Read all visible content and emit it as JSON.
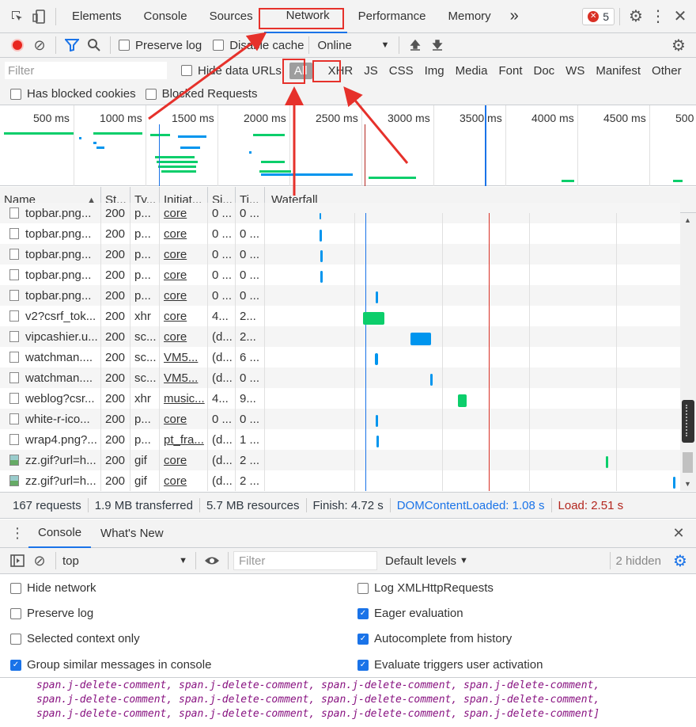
{
  "tabs": {
    "items": [
      "Elements",
      "Console",
      "Sources",
      "Network",
      "Performance",
      "Memory"
    ],
    "more": "»",
    "error_count": "5"
  },
  "toolbar": {
    "preserve_log": "Preserve log",
    "disable_cache": "Disable cache",
    "throttle": "Online"
  },
  "filter": {
    "placeholder": "Filter",
    "hide_data_urls": "Hide data URLs",
    "types": [
      "All",
      "XHR",
      "JS",
      "CSS",
      "Img",
      "Media",
      "Font",
      "Doc",
      "WS",
      "Manifest",
      "Other"
    ],
    "has_blocked_cookies": "Has blocked cookies",
    "blocked_requests": "Blocked Requests"
  },
  "overview": {
    "ticks": [
      "500 ms",
      "1000 ms",
      "1500 ms",
      "2000 ms",
      "2500 ms",
      "3000 ms",
      "3500 ms",
      "4000 ms",
      "4500 ms",
      "500"
    ]
  },
  "table": {
    "headers": [
      "Name",
      "St...",
      "Ty...",
      "Initiat...",
      "Si...",
      "Ti...",
      "Waterfall"
    ],
    "rows": [
      {
        "name": "topbar.png...",
        "status": "200",
        "type": "p...",
        "initiator": "core",
        "size": "0 ...",
        "time": "0 ...",
        "icon": "img"
      },
      {
        "name": "topbar.png...",
        "status": "200",
        "type": "p...",
        "initiator": "core",
        "size": "0 ...",
        "time": "0 ...",
        "icon": "img"
      },
      {
        "name": "topbar.png...",
        "status": "200",
        "type": "p...",
        "initiator": "core",
        "size": "0 ...",
        "time": "0 ...",
        "icon": "img"
      },
      {
        "name": "topbar.png...",
        "status": "200",
        "type": "p...",
        "initiator": "core",
        "size": "0 ...",
        "time": "0 ...",
        "icon": "img"
      },
      {
        "name": "topbar.png...",
        "status": "200",
        "type": "p...",
        "initiator": "core",
        "size": "0 ...",
        "time": "0 ...",
        "icon": "img"
      },
      {
        "name": "v2?csrf_tok...",
        "status": "200",
        "type": "xhr",
        "initiator": "core",
        "size": "4...",
        "time": "2...",
        "icon": "doc"
      },
      {
        "name": "vipcashier.u...",
        "status": "200",
        "type": "sc...",
        "initiator": "core",
        "size": "(d...",
        "time": "2...",
        "icon": "doc"
      },
      {
        "name": "watchman....",
        "status": "200",
        "type": "sc...",
        "initiator": "VM5...",
        "size": "(d...",
        "time": "6 ...",
        "icon": "doc"
      },
      {
        "name": "watchman....",
        "status": "200",
        "type": "sc...",
        "initiator": "VM5...",
        "size": "(d...",
        "time": "0 ...",
        "icon": "doc"
      },
      {
        "name": "weblog?csr...",
        "status": "200",
        "type": "xhr",
        "initiator": "music...",
        "size": "4...",
        "time": "9...",
        "icon": "doc"
      },
      {
        "name": "white-r-ico...",
        "status": "200",
        "type": "p...",
        "initiator": "core",
        "size": "0 ...",
        "time": "0 ...",
        "icon": "doc"
      },
      {
        "name": "wrap4.png?...",
        "status": "200",
        "type": "p...",
        "initiator": "pt_fra...",
        "size": "(d...",
        "time": "1 ...",
        "icon": "doc"
      },
      {
        "name": "zz.gif?url=h...",
        "status": "200",
        "type": "gif",
        "initiator": "core",
        "size": "(d...",
        "time": "2 ...",
        "icon": "pic"
      },
      {
        "name": "zz.gif?url=h...",
        "status": "200",
        "type": "gif",
        "initiator": "core",
        "size": "(d...",
        "time": "2 ...",
        "icon": "pic"
      }
    ]
  },
  "summary": {
    "requests": "167 requests",
    "transferred": "1.9 MB transferred",
    "resources": "5.7 MB resources",
    "finish": "Finish: 4.72 s",
    "dcl": "DOMContentLoaded: 1.08 s",
    "load": "Load: 2.51 s"
  },
  "drawer": {
    "tabs": [
      "Console",
      "What's New"
    ],
    "context": "top",
    "filter_placeholder": "Filter",
    "levels": "Default levels",
    "hidden": "2 hidden",
    "settings": {
      "hide_network": "Hide network",
      "preserve_log": "Preserve log",
      "selected_context": "Selected context only",
      "group_similar": "Group similar messages in console",
      "log_xhr": "Log XMLHttpRequests",
      "eager_eval": "Eager evaluation",
      "autocomplete": "Autocomplete from history",
      "eval_triggers": "Evaluate triggers user activation"
    },
    "output_lines": [
      "span.j-delete-comment, span.j-delete-comment, span.j-delete-comment, span.j-delete-comment,",
      "span.j-delete-comment, span.j-delete-comment, span.j-delete-comment, span.j-delete-comment,",
      "span.j-delete-comment, span.j-delete-comment, span.j-delete-comment, span.j-delete-comment]"
    ]
  },
  "colors": {
    "accent": "#1a73e8",
    "annotation": "#e6312b",
    "bar_green": "#0cce6b",
    "bar_blue": "#0095ee"
  }
}
